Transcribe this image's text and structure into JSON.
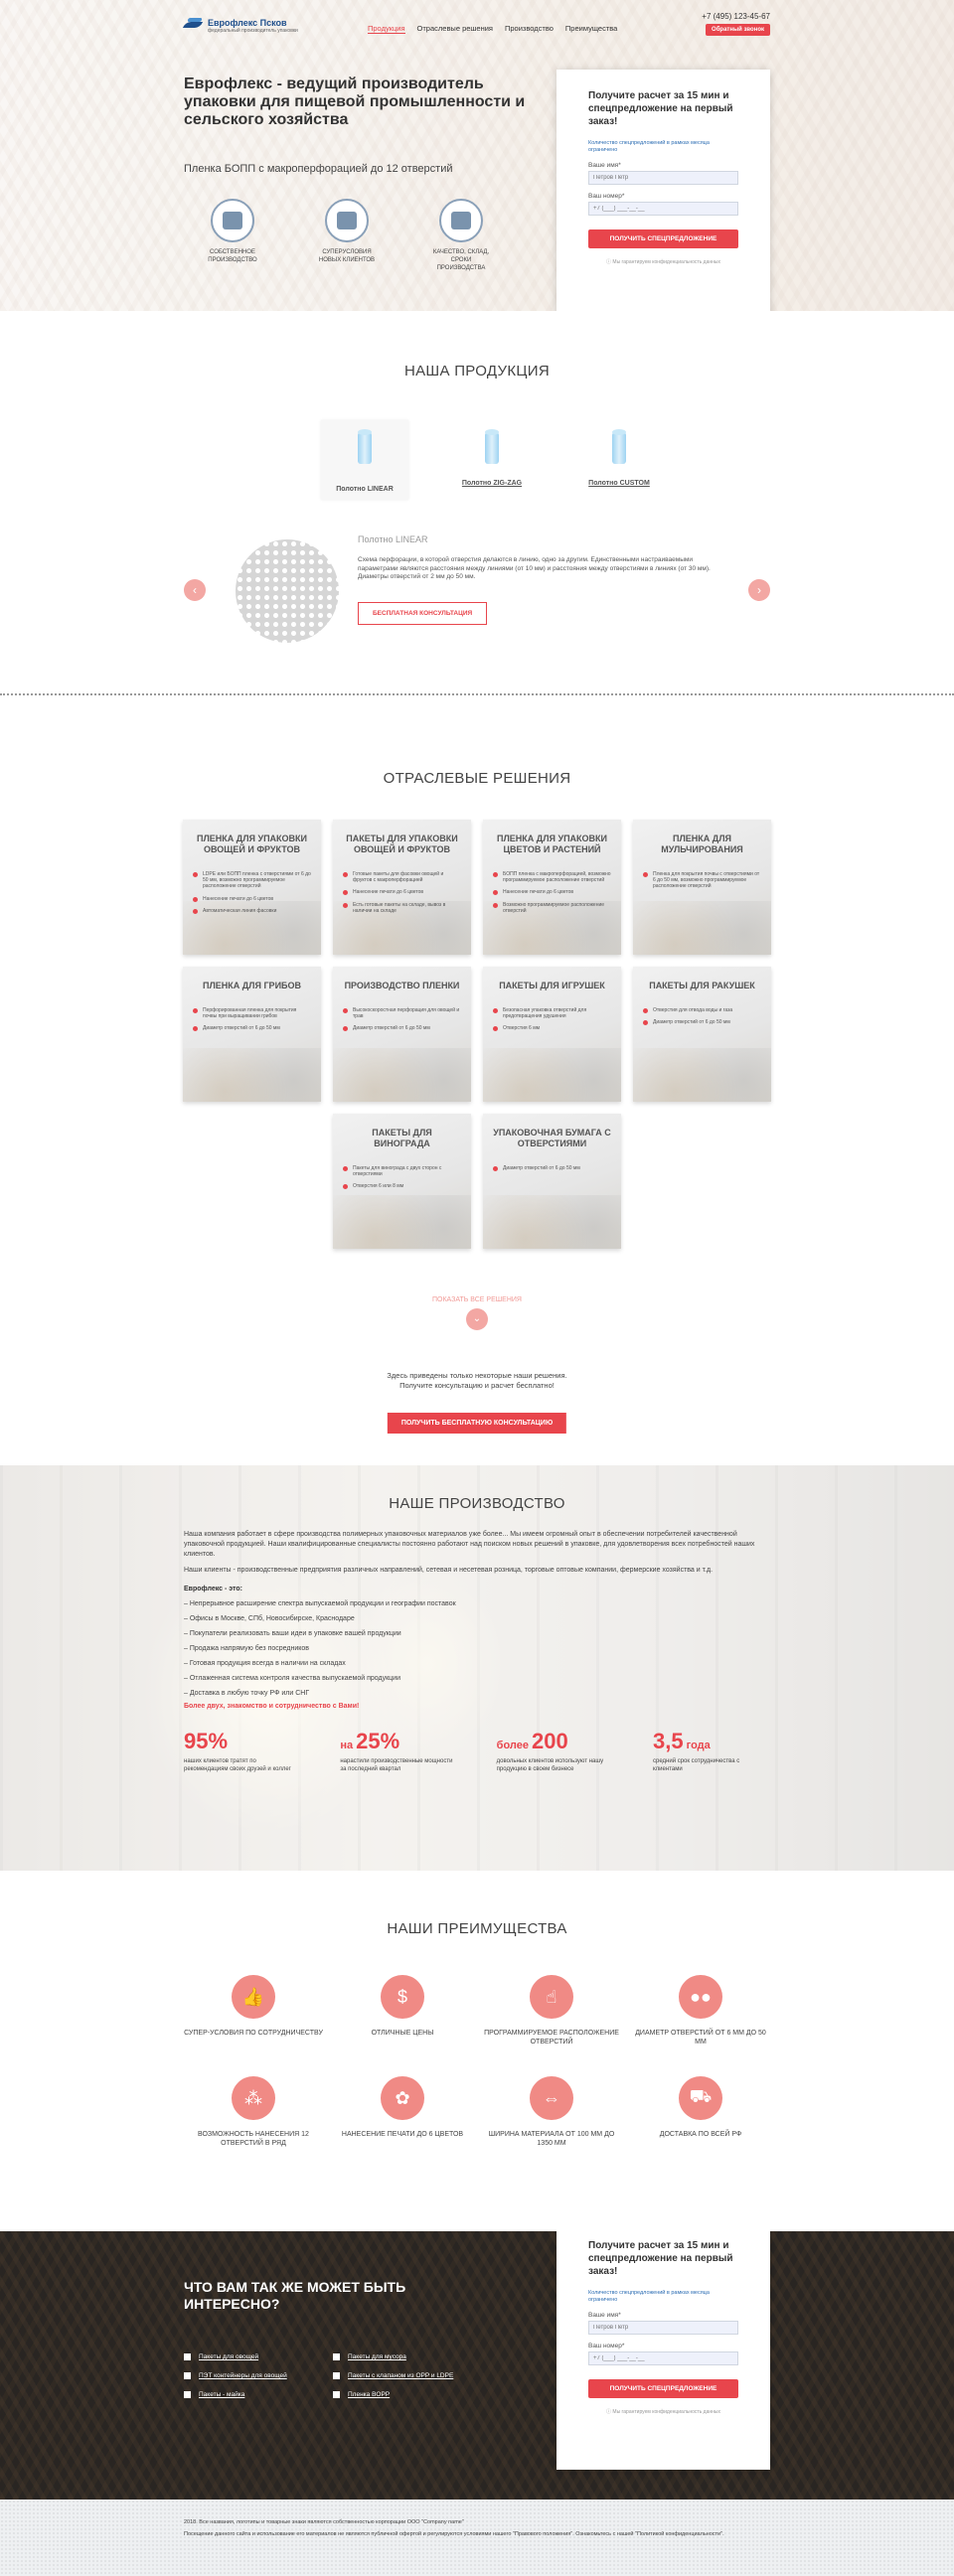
{
  "header": {
    "logo_name": "Еврофлекс Псков",
    "logo_sub": "федеральный производитель упаковки",
    "nav": [
      "Продукция",
      "Отраслевые решения",
      "Производство",
      "Преимущества"
    ],
    "phone": "+7 (495) 123-45-67",
    "callback": "Обратный звонок"
  },
  "hero": {
    "title_bold": "Еврофлекс",
    "title_rest": " - ведущий производитель упаковки для пищевой промышленности и сельского хозяйства",
    "subtitle": "Пленка БОПП с макроперфорацией до 12 отверстий",
    "features": [
      {
        "label": "Собственное производство",
        "icon": "factory-icon"
      },
      {
        "label": "Суперусловия новых клиентов",
        "icon": "thumbs-up-icon"
      },
      {
        "label": "Качество, склад, сроки производства",
        "icon": "forklift-icon"
      }
    ]
  },
  "form": {
    "title": "Получите расчет за 15 мин и спецпредложение на первый заказ!",
    "note": "Количество спецпредложений в рамках месяца ограничено",
    "name_label": "Ваше имя*",
    "name_placeholder": "Петров Петр",
    "phone_label": "Ваш номер*",
    "phone_placeholder": "+7 (___) ___-__-__",
    "button": "Получить спецпредложение",
    "privacy": "Мы гарантируем конфиденциальность данных"
  },
  "products": {
    "title": "Наша продукция",
    "tabs": [
      "Полотно LINEAR",
      "Полотно ZIG-ZAG",
      "Полотно CUSTOM"
    ],
    "active_title": "Полотно LINEAR",
    "active_text": "Схема перфорации, в которой отверстия делаются в линию, одно за другим. Единственными настраиваемыми параметрами являются расстояния между линиями (от 10 мм) и расстояния между отверстиями в линиях (от 30 мм). Диаметры отверстий от 2 мм до 50 мм.",
    "consult_button": "Бесплатная консультация"
  },
  "solutions": {
    "title": "Отраслевые решения",
    "cards": [
      {
        "title": "Пленка для упаковки овощей и фруктов",
        "items": [
          "LDPE или БОПП пленка с отверстиями от 6 до 50 мм, возможно программируемое расположение отверстий",
          "Нанесение печати до 6 цветов",
          "Автоматическая линия фасовки"
        ]
      },
      {
        "title": "Пакеты для упаковки овощей и фруктов",
        "items": [
          "Готовые пакеты для фасовки овощей и фруктов с макроперфорацией",
          "Нанесение печати до 6 цветов",
          "Есть готовые пакеты на складе, вывоз в наличии на складе"
        ]
      },
      {
        "title": "Пленка для упаковки цветов и растений",
        "items": [
          "БОПП пленка с макроперфорацией, возможно программируемое расположение отверстий",
          "Нанесение печати до 6 цветов",
          "Возможно программируемое расположение отверстий"
        ]
      },
      {
        "title": "Пленка для мульчирования",
        "items": [
          "Пленка для покрытия почвы с отверстиями от 6 до 50 мм, возможно программируемое расположение отверстий"
        ]
      },
      {
        "title": "Пленка для грибов",
        "items": [
          "Перфорированная пленка для покрытия почвы при выращивании грибов",
          "Диаметр отверстий от 6 до 50 мм"
        ]
      },
      {
        "title": "Производство пленки",
        "items": [
          "Высокоскоростная перфорация для овощей и трав",
          "Диаметр отверстий от 6 до 50 мм"
        ]
      },
      {
        "title": "Пакеты для игрушек",
        "items": [
          "Безопасная упаковка отверстий для предотвращения удушения",
          "Отверстия 6 мм"
        ]
      },
      {
        "title": "Пакеты для ракушек",
        "items": [
          "Отверстия для отвода воды и газа",
          "Диаметр отверстий от 6 до 50 мм"
        ]
      },
      {
        "title": "Пакеты для винограда",
        "items": [
          "Пакеты для винограда с двух сторон с отверстиями",
          "Отверстия 6 или 8 мм"
        ]
      },
      {
        "title": "Упаковочная бумага с отверстиями",
        "items": [
          "Диаметр отверстий от 6 до 50 мм"
        ]
      }
    ],
    "show_all": "Показать все решения",
    "note_line1": "Здесь приведены только некоторые наши решения.",
    "note_line2": "Получите консультацию и расчет бесплатно!",
    "cta": "Получить бесплатную консультацию"
  },
  "production": {
    "title": "Наше производство",
    "text1": "Наша компания работает в сфере производства полимерных упаковочных материалов уже более... Мы имеем огромный опыт в обеспечении потребителей качественной упаковочной продукцией. Наши квалифицированные специалисты постоянно работают над поиском новых решений в упаковке, для удовлетворения всех потребностей наших клиентов.",
    "text2": "Наши клиенты - производственные предприятия различных направлений, сетевая и несетевая розница, торговые оптовые компании, фермерские хозяйства и т.д.",
    "head": "Еврофлекс - это:",
    "items": [
      "Непрерывное расширение спектра выпускаемой продукции и географии поставок",
      "Офисы в Москве, СПб, Новосибирске, Краснодаре",
      "Покупатели реализовать ваши идеи в упаковке вашей продукции",
      "Продажа напрямую без посредников",
      "Готовая продукция всегда в наличии на складах",
      "Отлаженная система контроля качества выпускаемой продукции",
      "Доставка в любую точку РФ или СНГ"
    ],
    "red_text": "Более двух, знакомство и сотрудничество с Вами!",
    "stats": [
      {
        "prefix": "",
        "num": "95%",
        "suffix": "",
        "desc": "наших клиентов тратят по рекомендациям своих друзей и коллег"
      },
      {
        "prefix": "на ",
        "num": "25%",
        "suffix": "",
        "desc": "нарастили производственные мощности за последний квартал"
      },
      {
        "prefix": "более ",
        "num": "200",
        "suffix": "",
        "desc": "довольных клиентов используют нашу продукцию в своем бизнесе"
      },
      {
        "prefix": "",
        "num": "3,5",
        "suffix": " года",
        "desc": "средний срок сотрудничества с клиентами"
      }
    ]
  },
  "advantages": {
    "title": "Наши преимущества",
    "items": [
      {
        "label": "Супер-условия по сотрудничеству",
        "icon": "thumbs-up-icon"
      },
      {
        "label": "Отличные цены",
        "icon": "money-icon"
      },
      {
        "label": "Программируемое расположение отверстий",
        "icon": "cursor-icon"
      },
      {
        "label": "Диаметр отверстий от 6 мм до 50 мм",
        "icon": "circles-icon"
      },
      {
        "label": "Возможность нанесения 12 отверстий в ряд",
        "icon": "grid-icon"
      },
      {
        "label": "Нанесение печати до 6 цветов",
        "icon": "palette-icon"
      },
      {
        "label": "Ширина материала от 100 мм до 1350 мм",
        "icon": "width-arrows-icon"
      },
      {
        "label": "Доставка по всей РФ",
        "icon": "truck-icon"
      }
    ]
  },
  "interest": {
    "title": "Что вам так же может быть интересно?",
    "links": [
      "Пакеты для овощей",
      "Пакеты для мусора",
      "ПЭТ контейнеры для овощей",
      "Пакеты с клапаном из OPP и LDPE",
      "Пакеты - майка",
      "Пленка BOPP"
    ]
  },
  "footer": {
    "line1": "2018. Все названия, логотипы и товарные знаки являются собственностью корпорации ООО \"Company name\"",
    "line2": "Посещение данного сайта и использование его материалов не являются публичной офертой и регулируются условиями нашего \"Правового положения\". Ознакомьтесь с нашей \"Политикой конфиденциальности\"."
  }
}
